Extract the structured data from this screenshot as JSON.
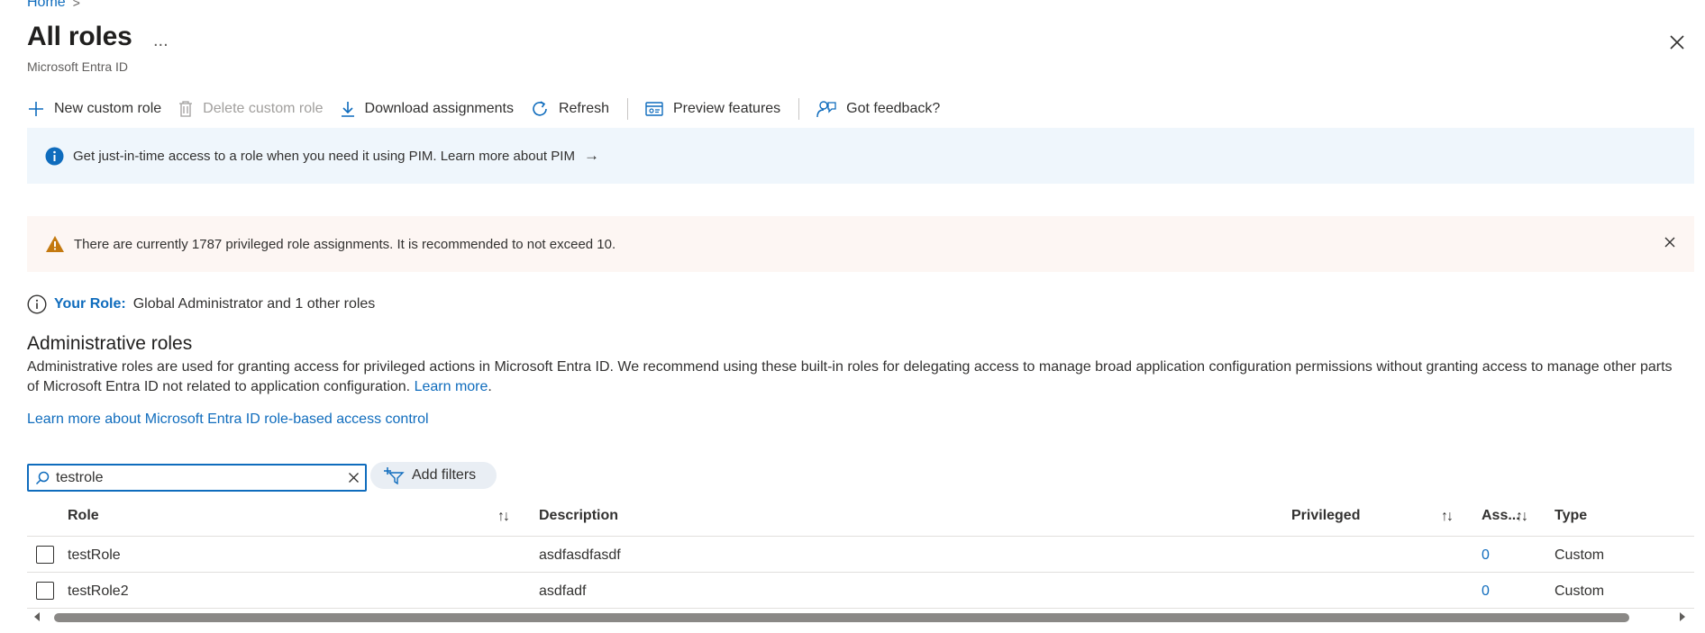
{
  "breadcrumb": {
    "home": "Home",
    "separator": ">"
  },
  "header": {
    "title": "All roles",
    "more": "...",
    "subtitle": "Microsoft Entra ID"
  },
  "toolbar": {
    "new_custom_role": "New custom role",
    "delete_custom_role": "Delete custom role",
    "download_assignments": "Download assignments",
    "refresh": "Refresh",
    "preview_features": "Preview features",
    "got_feedback": "Got feedback?"
  },
  "info_banner": {
    "text": "Get just-in-time access to a role when you need it using PIM. Learn more about PIM",
    "arrow": "→"
  },
  "warning_banner": {
    "text": "There are currently 1787 privileged role assignments. It is recommended to not exceed 10."
  },
  "your_role": {
    "label": "Your Role:",
    "value": "Global Administrator and 1 other roles"
  },
  "admin_roles": {
    "title": "Administrative roles",
    "description": "Administrative roles are used for granting access for privileged actions in Microsoft Entra ID. We recommend using these built-in roles for delegating access to manage broad application configuration permissions without granting access to manage other parts of Microsoft Entra ID not related to application configuration.",
    "learn_more": "Learn more",
    "period": ".",
    "rbac_link": "Learn more about Microsoft Entra ID role-based access control"
  },
  "search": {
    "value": "testrole"
  },
  "filters": {
    "add_filters": "Add filters"
  },
  "table": {
    "columns": {
      "role": "Role",
      "description": "Description",
      "privileged": "Privileged",
      "assignments": "Ass...",
      "type": "Type"
    },
    "sort_glyph": "↑↓",
    "rows": [
      {
        "role": "testRole",
        "description": "asdfasdfasdf",
        "privileged": "",
        "assignments": "0",
        "type": "Custom"
      },
      {
        "role": "testRole2",
        "description": "asdfadf",
        "privileged": "",
        "assignments": "0",
        "type": "Custom"
      }
    ]
  },
  "colors": {
    "accent": "#0f6cbd",
    "info_bg": "#eff6fc",
    "warning_bg": "#fdf6f3",
    "warning_icon": "#c4790f",
    "text": "#323130"
  }
}
